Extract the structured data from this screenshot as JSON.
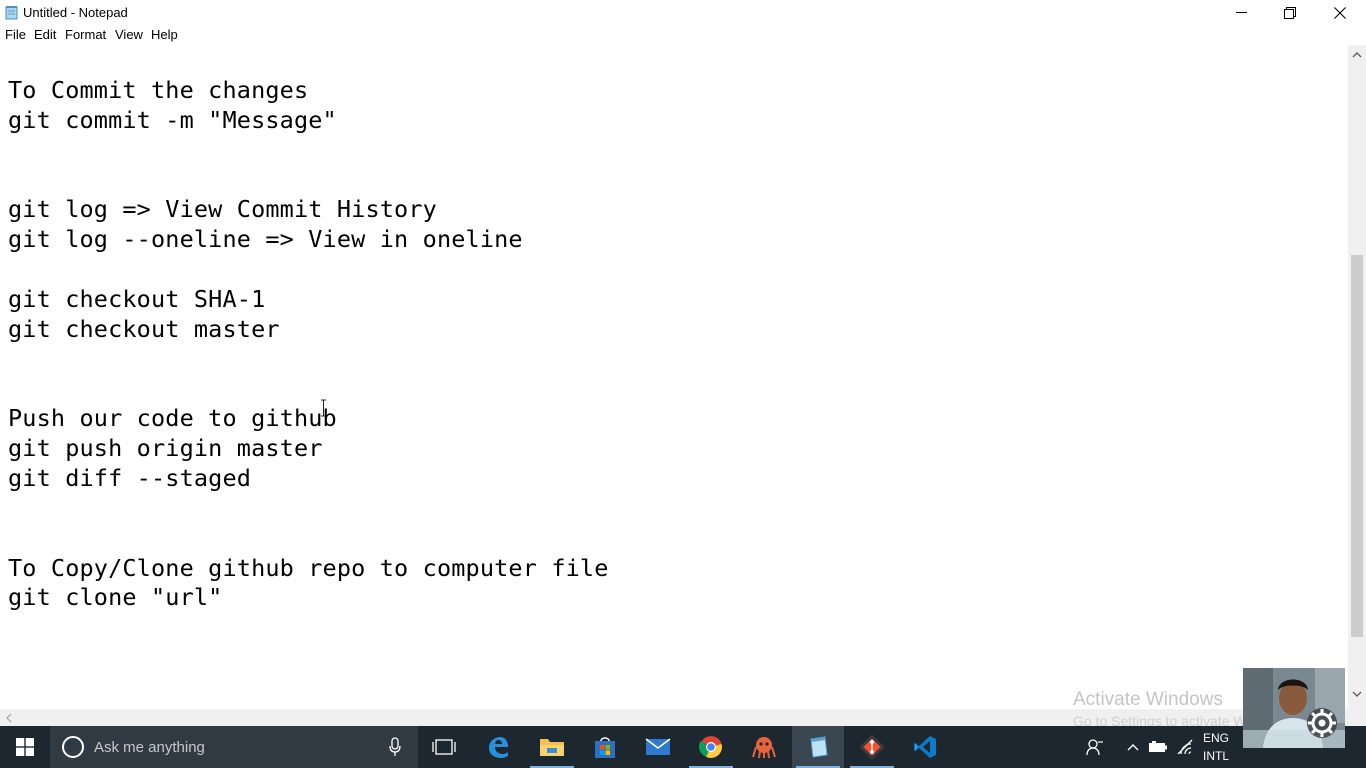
{
  "window": {
    "title": "Untitled - Notepad",
    "buttons": {
      "minimize": "minimize",
      "maximize": "restore",
      "close": "close"
    }
  },
  "menu": [
    "File",
    "Edit",
    "Format",
    "View",
    "Help"
  ],
  "editor": {
    "lines": [
      "To Commit the changes",
      "git commit -m \"Message\"",
      "",
      "",
      "git log => View Commit History",
      "git log --oneline => View in oneline",
      "",
      "git checkout SHA-1",
      "git checkout master",
      "",
      "",
      "Push our code to github",
      "git push origin master",
      "git diff --staged",
      "",
      "",
      "To Copy/Clone github repo to computer file",
      "git clone \"url\""
    ]
  },
  "watermark": {
    "title": "Activate Windows",
    "subtitle": "Go to Settings to activate Windows."
  },
  "taskbar": {
    "search_placeholder": "Ask me anything",
    "apps": [
      "task-view",
      "edge",
      "file-explorer",
      "store",
      "mail",
      "chrome",
      "gitkraken",
      "notepad",
      "git",
      "vscode"
    ],
    "active_app": "notepad",
    "language": {
      "line1": "ENG",
      "line2": "INTL"
    }
  },
  "colors": {
    "taskbar": "#1d2730",
    "search": "#303a43",
    "accent": "#7fb0e0"
  }
}
